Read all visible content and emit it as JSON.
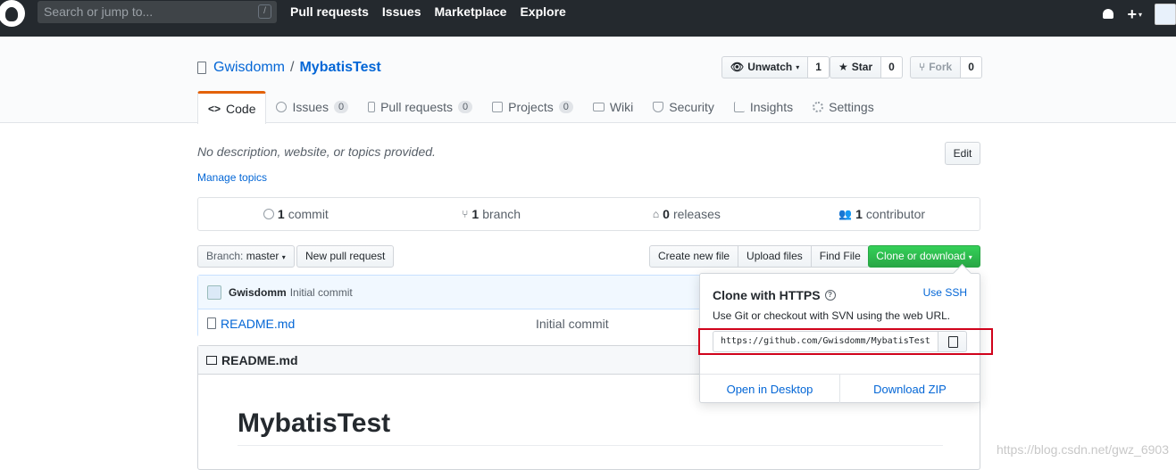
{
  "topbar": {
    "search_placeholder": "Search or jump to...",
    "search_key": "/",
    "nav": [
      "Pull requests",
      "Issues",
      "Marketplace",
      "Explore"
    ],
    "plus": "+",
    "caret": "▾"
  },
  "repo": {
    "owner": "Gwisdomm",
    "separator": "/",
    "name": "MybatisTest"
  },
  "actions": {
    "watch_label": "Unwatch",
    "watch_caret": "▾",
    "watch_count": "1",
    "star_label": "Star",
    "star_count": "0",
    "fork_label": "Fork",
    "fork_count": "0"
  },
  "tabs": [
    {
      "label": "Code",
      "count": null
    },
    {
      "label": "Issues",
      "count": "0"
    },
    {
      "label": "Pull requests",
      "count": "0"
    },
    {
      "label": "Projects",
      "count": "0"
    },
    {
      "label": "Wiki",
      "count": null
    },
    {
      "label": "Security",
      "count": null
    },
    {
      "label": "Insights",
      "count": null
    },
    {
      "label": "Settings",
      "count": null
    }
  ],
  "about": {
    "description": "No description, website, or topics provided.",
    "edit_label": "Edit",
    "manage_topics": "Manage topics"
  },
  "summary": {
    "commits_num": "1",
    "commits_label": "commit",
    "branches_num": "1",
    "branches_label": "branch",
    "releases_num": "0",
    "releases_label": "releases",
    "contributors_num": "1",
    "contributors_label": "contributor"
  },
  "toolbar": {
    "branch_prefix": "Branch:",
    "branch_name": "master",
    "branch_caret": "▾",
    "new_pr": "New pull request",
    "create_file": "Create new file",
    "upload_files": "Upload files",
    "find_file": "Find File",
    "clone_download": "Clone or download",
    "clone_caret": "▾"
  },
  "commit": {
    "author": "Gwisdomm",
    "message": "Initial commit"
  },
  "files": [
    {
      "name": "README.md",
      "message": "Initial commit"
    }
  ],
  "readme": {
    "filename": "README.md",
    "title": "MybatisTest"
  },
  "clone_popover": {
    "title": "Clone with HTTPS",
    "help": "?",
    "use_ssh": "Use SSH",
    "description": "Use Git or checkout with SVN using the web URL.",
    "url": "https://github.com/Gwisdomm/MybatisTest",
    "open_desktop": "Open in Desktop",
    "download_zip": "Download ZIP"
  },
  "watermark": "https://blog.csdn.net/gwz_6903",
  "colors": {
    "topbar": "#24292e",
    "link": "#0366d6",
    "primary_button": "#28a745",
    "active_tab_accent": "#e36209",
    "highlight_box": "#d0021b"
  }
}
